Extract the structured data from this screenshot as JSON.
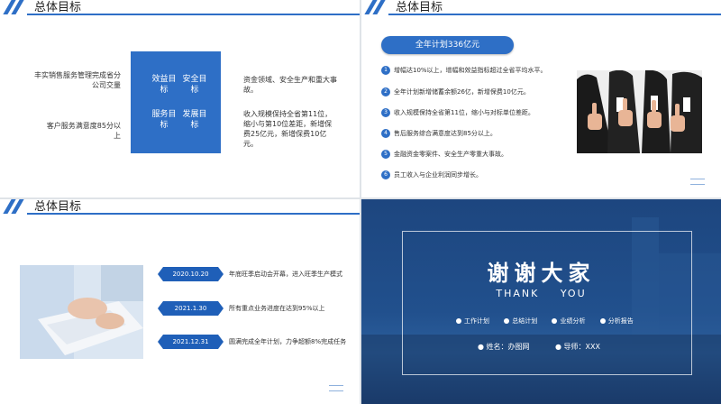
{
  "slide1": {
    "title": "总体目标",
    "left_text_1": "丰实销售服务管理完成省分公司交量",
    "left_text_2": "客户服务满意度85分以上",
    "box": [
      "效益目标",
      "安全目标",
      "服务目标",
      "发展目标"
    ],
    "right_text_1": "资金领域、安全生产和重大事故。",
    "right_text_2": "收入规模保持全省第11位，缩小与第10位差距，新增保费25亿元，新增保费10亿元。"
  },
  "slide2": {
    "title": "总体目标",
    "pill": "全年计划336亿元",
    "items": [
      {
        "num": "1",
        "text": "增幅达10%以上，增幅和效益指标超过全省平均水平。"
      },
      {
        "num": "2",
        "text": "全年计划新增储蓄余额26亿，新增保费10亿元。"
      },
      {
        "num": "3",
        "text": "收入规模保持全省第11位，缩小与对标单位差距。"
      },
      {
        "num": "4",
        "text": "售后服务综合满意度达到85分以上。"
      },
      {
        "num": "5",
        "text": "金融资金零案件、安全生产零重大事故。"
      },
      {
        "num": "6",
        "text": "员工收入与企业利润同步增长。"
      }
    ]
  },
  "slide3": {
    "title": "总体目标",
    "timeline": [
      {
        "date": "2020.10.20",
        "text": "年底旺季启动会开幕，进入旺季生产模式"
      },
      {
        "date": "2021.1.30",
        "text": "所有重点业务进度在达到95%以上"
      },
      {
        "date": "2021.12.31",
        "text": "圆满完成全年计划，力争超额8%完成任务"
      }
    ]
  },
  "slide4": {
    "thanks": "谢谢大家",
    "thanks_en": "THANK YOU",
    "links": [
      "工作计划",
      "总结计划",
      "业绩分析",
      "分析报告"
    ],
    "name": "姓名：办图网",
    "mentor": "导师：XXX"
  }
}
